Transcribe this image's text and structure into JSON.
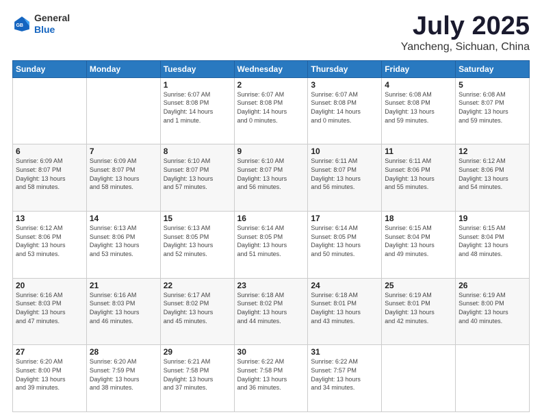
{
  "header": {
    "logo_line1": "General",
    "logo_line2": "Blue",
    "month": "July 2025",
    "location": "Yancheng, Sichuan, China"
  },
  "weekdays": [
    "Sunday",
    "Monday",
    "Tuesday",
    "Wednesday",
    "Thursday",
    "Friday",
    "Saturday"
  ],
  "weeks": [
    [
      {
        "day": "",
        "info": ""
      },
      {
        "day": "",
        "info": ""
      },
      {
        "day": "1",
        "info": "Sunrise: 6:07 AM\nSunset: 8:08 PM\nDaylight: 14 hours\nand 1 minute."
      },
      {
        "day": "2",
        "info": "Sunrise: 6:07 AM\nSunset: 8:08 PM\nDaylight: 14 hours\nand 0 minutes."
      },
      {
        "day": "3",
        "info": "Sunrise: 6:07 AM\nSunset: 8:08 PM\nDaylight: 14 hours\nand 0 minutes."
      },
      {
        "day": "4",
        "info": "Sunrise: 6:08 AM\nSunset: 8:08 PM\nDaylight: 13 hours\nand 59 minutes."
      },
      {
        "day": "5",
        "info": "Sunrise: 6:08 AM\nSunset: 8:07 PM\nDaylight: 13 hours\nand 59 minutes."
      }
    ],
    [
      {
        "day": "6",
        "info": "Sunrise: 6:09 AM\nSunset: 8:07 PM\nDaylight: 13 hours\nand 58 minutes."
      },
      {
        "day": "7",
        "info": "Sunrise: 6:09 AM\nSunset: 8:07 PM\nDaylight: 13 hours\nand 58 minutes."
      },
      {
        "day": "8",
        "info": "Sunrise: 6:10 AM\nSunset: 8:07 PM\nDaylight: 13 hours\nand 57 minutes."
      },
      {
        "day": "9",
        "info": "Sunrise: 6:10 AM\nSunset: 8:07 PM\nDaylight: 13 hours\nand 56 minutes."
      },
      {
        "day": "10",
        "info": "Sunrise: 6:11 AM\nSunset: 8:07 PM\nDaylight: 13 hours\nand 56 minutes."
      },
      {
        "day": "11",
        "info": "Sunrise: 6:11 AM\nSunset: 8:06 PM\nDaylight: 13 hours\nand 55 minutes."
      },
      {
        "day": "12",
        "info": "Sunrise: 6:12 AM\nSunset: 8:06 PM\nDaylight: 13 hours\nand 54 minutes."
      }
    ],
    [
      {
        "day": "13",
        "info": "Sunrise: 6:12 AM\nSunset: 8:06 PM\nDaylight: 13 hours\nand 53 minutes."
      },
      {
        "day": "14",
        "info": "Sunrise: 6:13 AM\nSunset: 8:06 PM\nDaylight: 13 hours\nand 53 minutes."
      },
      {
        "day": "15",
        "info": "Sunrise: 6:13 AM\nSunset: 8:05 PM\nDaylight: 13 hours\nand 52 minutes."
      },
      {
        "day": "16",
        "info": "Sunrise: 6:14 AM\nSunset: 8:05 PM\nDaylight: 13 hours\nand 51 minutes."
      },
      {
        "day": "17",
        "info": "Sunrise: 6:14 AM\nSunset: 8:05 PM\nDaylight: 13 hours\nand 50 minutes."
      },
      {
        "day": "18",
        "info": "Sunrise: 6:15 AM\nSunset: 8:04 PM\nDaylight: 13 hours\nand 49 minutes."
      },
      {
        "day": "19",
        "info": "Sunrise: 6:15 AM\nSunset: 8:04 PM\nDaylight: 13 hours\nand 48 minutes."
      }
    ],
    [
      {
        "day": "20",
        "info": "Sunrise: 6:16 AM\nSunset: 8:03 PM\nDaylight: 13 hours\nand 47 minutes."
      },
      {
        "day": "21",
        "info": "Sunrise: 6:16 AM\nSunset: 8:03 PM\nDaylight: 13 hours\nand 46 minutes."
      },
      {
        "day": "22",
        "info": "Sunrise: 6:17 AM\nSunset: 8:02 PM\nDaylight: 13 hours\nand 45 minutes."
      },
      {
        "day": "23",
        "info": "Sunrise: 6:18 AM\nSunset: 8:02 PM\nDaylight: 13 hours\nand 44 minutes."
      },
      {
        "day": "24",
        "info": "Sunrise: 6:18 AM\nSunset: 8:01 PM\nDaylight: 13 hours\nand 43 minutes."
      },
      {
        "day": "25",
        "info": "Sunrise: 6:19 AM\nSunset: 8:01 PM\nDaylight: 13 hours\nand 42 minutes."
      },
      {
        "day": "26",
        "info": "Sunrise: 6:19 AM\nSunset: 8:00 PM\nDaylight: 13 hours\nand 40 minutes."
      }
    ],
    [
      {
        "day": "27",
        "info": "Sunrise: 6:20 AM\nSunset: 8:00 PM\nDaylight: 13 hours\nand 39 minutes."
      },
      {
        "day": "28",
        "info": "Sunrise: 6:20 AM\nSunset: 7:59 PM\nDaylight: 13 hours\nand 38 minutes."
      },
      {
        "day": "29",
        "info": "Sunrise: 6:21 AM\nSunset: 7:58 PM\nDaylight: 13 hours\nand 37 minutes."
      },
      {
        "day": "30",
        "info": "Sunrise: 6:22 AM\nSunset: 7:58 PM\nDaylight: 13 hours\nand 36 minutes."
      },
      {
        "day": "31",
        "info": "Sunrise: 6:22 AM\nSunset: 7:57 PM\nDaylight: 13 hours\nand 34 minutes."
      },
      {
        "day": "",
        "info": ""
      },
      {
        "day": "",
        "info": ""
      }
    ]
  ]
}
